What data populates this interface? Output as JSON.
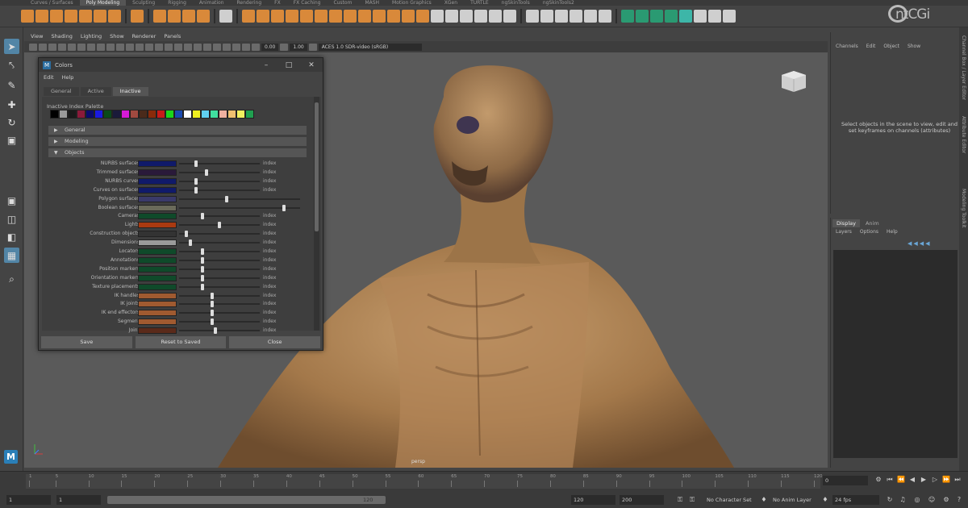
{
  "shelf_tabs": [
    "Curves / Surfaces",
    "Poly Modeling",
    "Sculpting",
    "Rigging",
    "Animation",
    "Rendering",
    "FX",
    "FX Caching",
    "Custom",
    "MASH",
    "Motion Graphics",
    "XGen",
    "TURTLE",
    "ngSkinTools",
    "ngSkinTools2"
  ],
  "active_shelf_tab": 1,
  "viewport_menu": [
    "View",
    "Shading",
    "Lighting",
    "Show",
    "Renderer",
    "Panels"
  ],
  "viewport_toolbar": {
    "exposure": "0.00",
    "gamma": "1.00",
    "colorspace": "ACES 1.0 SDR-video (sRGB)"
  },
  "colors_dialog": {
    "title": "Colors",
    "menu": [
      "Edit",
      "Help"
    ],
    "tabs": [
      "General",
      "Active",
      "Inactive"
    ],
    "active_tab": 2,
    "palette_label": "Inactive Index Palette",
    "palette": [
      "#000000",
      "#9a9a9a",
      "#1a1a1a",
      "#8a1a3a",
      "#0b0b6e",
      "#1a1ae0",
      "#0a4a1a",
      "#1a1a3a",
      "#d61ad6",
      "#a04a40",
      "#4a2a1a",
      "#8a2a0a",
      "#c81a1a",
      "#1ad61a",
      "#1a4ab0",
      "#ffffff",
      "#f0f020",
      "#60d0f0",
      "#40e0a0",
      "#f0b0a0",
      "#f0c070",
      "#f0f060",
      "#20a050"
    ],
    "sections": {
      "general": "General",
      "modeling": "Modeling",
      "objects": "Objects"
    },
    "index_label": "index",
    "attributes": [
      {
        "label": "NURBS surfaces:",
        "color": "#101a6a",
        "value": 0.2
      },
      {
        "label": "Trimmed surfaces:",
        "color": "#2a1a3a",
        "value": 0.33
      },
      {
        "label": "NURBS curves:",
        "color": "#101a6a",
        "value": 0.2
      },
      {
        "label": "Curves on surfaces:",
        "color": "#101a6a",
        "value": 0.2
      },
      {
        "label": "Polygon surfaces:",
        "color": "#3a3a6a",
        "value": 0.39
      },
      {
        "label": "Boolean surfaces:",
        "color": "#6a6a5a",
        "value": 0.88
      },
      {
        "label": "Cameras:",
        "color": "#0f4a2a",
        "value": 0.28
      },
      {
        "label": "Lights:",
        "color": "#aa3a10",
        "value": 0.5
      },
      {
        "label": "Construction objects:",
        "color": "#333333",
        "value": 0.07
      },
      {
        "label": "Dimensions:",
        "color": "#9a9a9a",
        "value": 0.12
      },
      {
        "label": "Locators:",
        "color": "#0f4a2a",
        "value": 0.28
      },
      {
        "label": "Annotations:",
        "color": "#0f4a2a",
        "value": 0.28
      },
      {
        "label": "Position markers:",
        "color": "#0f4a2a",
        "value": 0.28
      },
      {
        "label": "Orientation markers:",
        "color": "#0f4a2a",
        "value": 0.28
      },
      {
        "label": "Texture placements:",
        "color": "#0f4a2a",
        "value": 0.28
      },
      {
        "label": "IK handles:",
        "color": "#a05a30",
        "value": 0.41
      },
      {
        "label": "IK joints:",
        "color": "#a05a30",
        "value": 0.41
      },
      {
        "label": "IK end effectors:",
        "color": "#a05a30",
        "value": 0.41
      },
      {
        "label": "Segment:",
        "color": "#a05a30",
        "value": 0.41
      },
      {
        "label": "Joint:",
        "color": "#5a2a1a",
        "value": 0.45
      }
    ],
    "buttons": {
      "save": "Save",
      "reset": "Reset to Saved",
      "close": "Close"
    }
  },
  "channel_box": {
    "menu": [
      "Channels",
      "Edit",
      "Object",
      "Show"
    ],
    "message": "Select objects in the scene to view, edit and set keyframes on channels (attributes)"
  },
  "layer_editor": {
    "tabs": [
      "Display",
      "Anim"
    ],
    "menu": [
      "Layers",
      "Options",
      "Help"
    ]
  },
  "right_strip": [
    "Channel Box / Layer Editor",
    "Attribute Editor",
    "Modeling Toolkit"
  ],
  "logo": "ntCGi",
  "viewport_label": "persp",
  "timeline": {
    "ticks": [
      1,
      5,
      10,
      15,
      20,
      25,
      30,
      35,
      40,
      45,
      50,
      55,
      60,
      65,
      70,
      75,
      80,
      85,
      90,
      95,
      100,
      105,
      110,
      115,
      120
    ],
    "current_frame": "0"
  },
  "range": {
    "start": "1",
    "playback_start": "1",
    "playback_end_inner": "120",
    "playback_end": "120",
    "end": "200",
    "character_set": "No Character Set",
    "anim_layer": "No Anim Layer",
    "fps": "24 fps"
  },
  "colors": {
    "accent": "#5285a6",
    "maya_blue": "#2a7fb8",
    "shelf_orange": "#d9893a",
    "shelf_green": "#2a9a72"
  }
}
